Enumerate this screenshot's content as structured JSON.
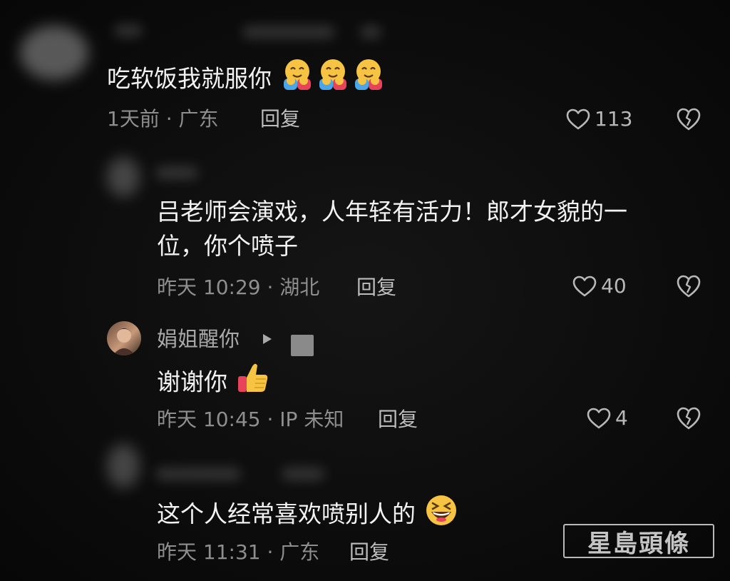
{
  "comments": [
    {
      "text": "吃软饭我就服你",
      "emojis": [
        "hugging-face-emoji",
        "hugging-face-emoji",
        "hugging-face-emoji"
      ],
      "meta": "1天前 · 广东",
      "reply_label": "回复",
      "likes": "113"
    },
    {
      "text_line1": "吕老师会演戏，人年轻有活力！郎才女貌的一",
      "text_line2": "位，你个喷子",
      "meta": "昨天 10:29 · 湖北",
      "reply_label": "回复",
      "likes": "40"
    },
    {
      "username": "娟姐醒你",
      "text": "谢谢你",
      "emoji": "thumbs-up-emoji",
      "meta": "昨天 10:45 · IP 未知",
      "reply_label": "回复",
      "likes": "4"
    },
    {
      "text": "这个人经常喜欢喷别人的",
      "emoji": "grinning-squinting-face-emoji",
      "meta": "昨天 11:31 · 广东",
      "reply_label": "回复"
    }
  ],
  "watermark": "星島頭條",
  "colors": {
    "background": "#0b0b0b",
    "text": "#f2f2f2",
    "meta": "#8e8e8e",
    "icon": "#b8b8b8"
  }
}
